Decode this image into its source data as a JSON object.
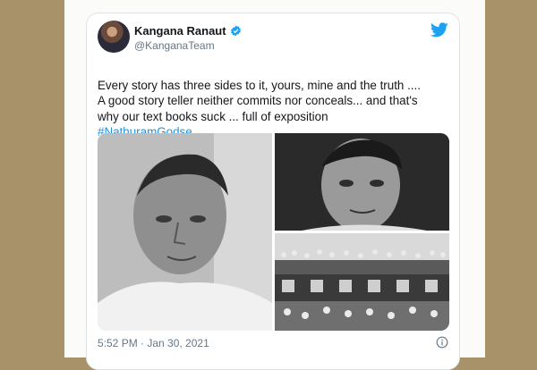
{
  "tweet": {
    "user": {
      "name": "Kangana Ranaut",
      "handle": "@KanganaTeam",
      "verified": true
    },
    "text": "Every story has three sides to it, yours, mine and the truth ....\nA good story teller neither commits nor conceals... and that's\nwhy our text books suck ... full of exposition",
    "hashtag": "#NathuramGodse",
    "timestamp": "5:52 PM · Jan 30, 2021",
    "media": [
      {
        "name": "portrait-left",
        "tone": "bw"
      },
      {
        "name": "portrait-topright",
        "tone": "bw"
      },
      {
        "name": "crowded-train",
        "tone": "bw"
      }
    ]
  },
  "colors": {
    "background": "#a8926a",
    "card": "#ffffff",
    "accent": "#1da1f2",
    "text": "#14171a",
    "muted": "#657786"
  },
  "icons": {
    "verified": "verified-badge-icon",
    "brand": "twitter-bird-icon",
    "info": "info-icon"
  }
}
